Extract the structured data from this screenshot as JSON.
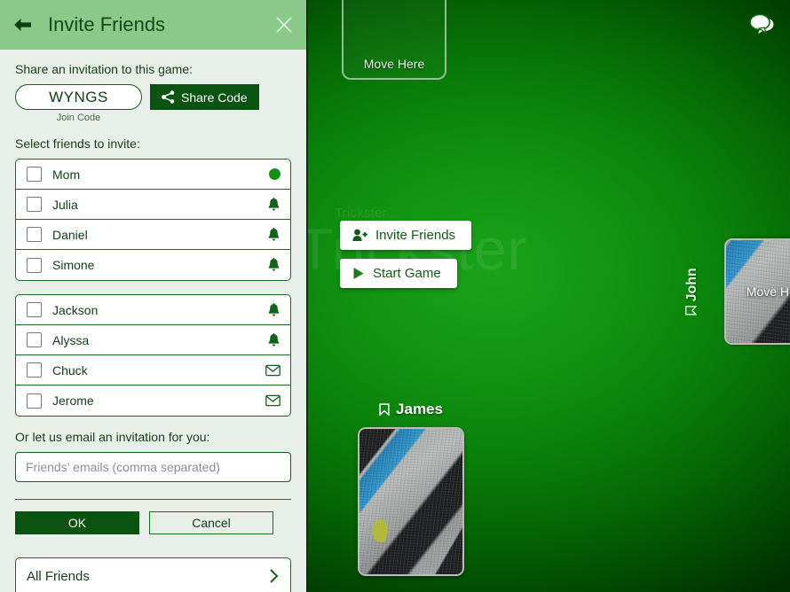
{
  "panel": {
    "header": {
      "title": "Invite Friends",
      "back_icon": "arrow-left-icon",
      "close_icon": "close-icon"
    },
    "share_section": {
      "label": "Share an invitation to this game:",
      "join_code": "WYNGS",
      "join_code_caption": "Join Code",
      "share_button_label": "Share Code",
      "share_button_icon": "share-icon"
    },
    "friends_section": {
      "label": "Select friends to invite:",
      "groups": [
        {
          "friends": [
            {
              "name": "Mom",
              "status_icon": "online-dot-icon",
              "checked": false
            },
            {
              "name": "Julia",
              "status_icon": "bell-icon",
              "checked": false
            },
            {
              "name": "Daniel",
              "status_icon": "bell-icon",
              "checked": false
            },
            {
              "name": "Simone",
              "status_icon": "bell-icon",
              "checked": false
            }
          ]
        },
        {
          "friends": [
            {
              "name": "Jackson",
              "status_icon": "bell-icon",
              "checked": false
            },
            {
              "name": "Alyssa",
              "status_icon": "bell-icon",
              "checked": false
            },
            {
              "name": "Chuck",
              "status_icon": "envelope-icon",
              "checked": false
            },
            {
              "name": "Jerome",
              "status_icon": "envelope-icon",
              "checked": false
            }
          ]
        }
      ]
    },
    "email_section": {
      "label": "Or let us email an invitation for you:",
      "placeholder": "Friends’ emails (comma separated)",
      "value": ""
    },
    "actions": {
      "ok_label": "OK",
      "cancel_label": "Cancel"
    },
    "all_friends": {
      "label": "All Friends",
      "chevron_icon": "chevron-right-icon"
    }
  },
  "game": {
    "watermark_small": "Trickster",
    "watermark_large": "Trickster",
    "chat_icon": "chat-bubbles-icon",
    "top_slot": {
      "label": "Move Here"
    },
    "actions": [
      {
        "label": "Invite Friends",
        "icon": "add-person-icon"
      },
      {
        "label": "Start Game",
        "icon": "play-icon"
      }
    ],
    "seats": [
      {
        "name": "James",
        "icon": "bookmark-icon",
        "card_overlay": ""
      },
      {
        "name": "John",
        "icon": "bookmark-icon",
        "card_overlay": "Move Here"
      }
    ]
  },
  "colors": {
    "header_green": "#8ac98a",
    "panel_bg": "#e8eee8",
    "accent_dark_green": "#0b5311",
    "table_green": "#0a800a",
    "online_dot": "#149114"
  }
}
